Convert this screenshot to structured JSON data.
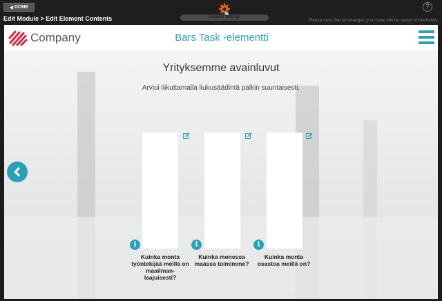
{
  "editor": {
    "done_label": "DONE",
    "breadcrumb": "Edit Module > Edit Element Contents",
    "element_settings": "Element Settings",
    "notice": "Please note that all changes you make will be saved immediately.",
    "help_label": "?"
  },
  "header": {
    "company": "Company",
    "title": "Bars Task -elementti"
  },
  "content": {
    "title": "Yrityksemme avainluvut",
    "subtitle": "Arvioi liikuttamalla liukusäädintä palkin suuntaisesti.",
    "bars": [
      {
        "question": "Kuinka monta työntekijää meillä on maailman-laajuisesti?"
      },
      {
        "question": "Kuinka monessa maassa toimimme?"
      },
      {
        "question": "Kuinka monta osastoa meillä on?"
      }
    ]
  },
  "colors": {
    "accent": "#2aa0b6",
    "logo_red": "#d9233f",
    "gear_orange": "#e2621b"
  },
  "icons": {
    "done": "triangle-left-icon",
    "settings": "gear-icon",
    "help": "help-icon",
    "menu": "hamburger-menu-icon",
    "prev": "chevron-left-icon",
    "edit": "edit-icon",
    "info": "info-icon"
  }
}
